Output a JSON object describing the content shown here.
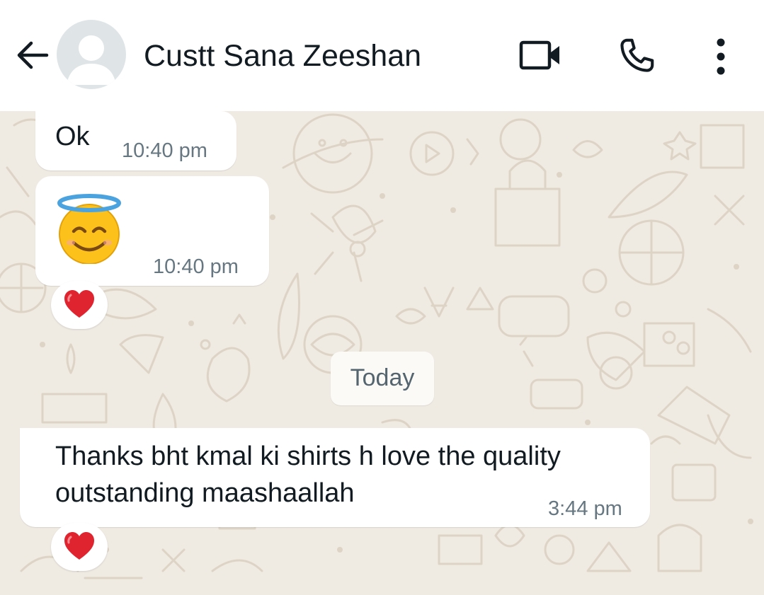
{
  "header": {
    "contact_name": "Custt Sana Zeeshan",
    "icons": {
      "back": "back-arrow-icon",
      "avatar": "default-avatar-icon",
      "video": "video-call-icon",
      "call": "phone-icon",
      "menu": "more-vertical-icon"
    }
  },
  "chat": {
    "date_separator": "Today",
    "messages": [
      {
        "text": "Ok",
        "time": "10:40 pm",
        "reaction": ""
      },
      {
        "text": "😇",
        "time": "10:40 pm",
        "reaction": "❤️"
      },
      {
        "text": "Thanks bht kmal ki shirts h love the quality outstanding maashaallah",
        "time": "3:44 pm",
        "reaction": "❤️"
      }
    ]
  },
  "colors": {
    "header_bg": "#ffffff",
    "chat_bg": "#efeae2",
    "bubble_bg": "#ffffff",
    "timestamp": "#667781",
    "text": "#111b21",
    "reaction_heart": "#e0242f"
  }
}
